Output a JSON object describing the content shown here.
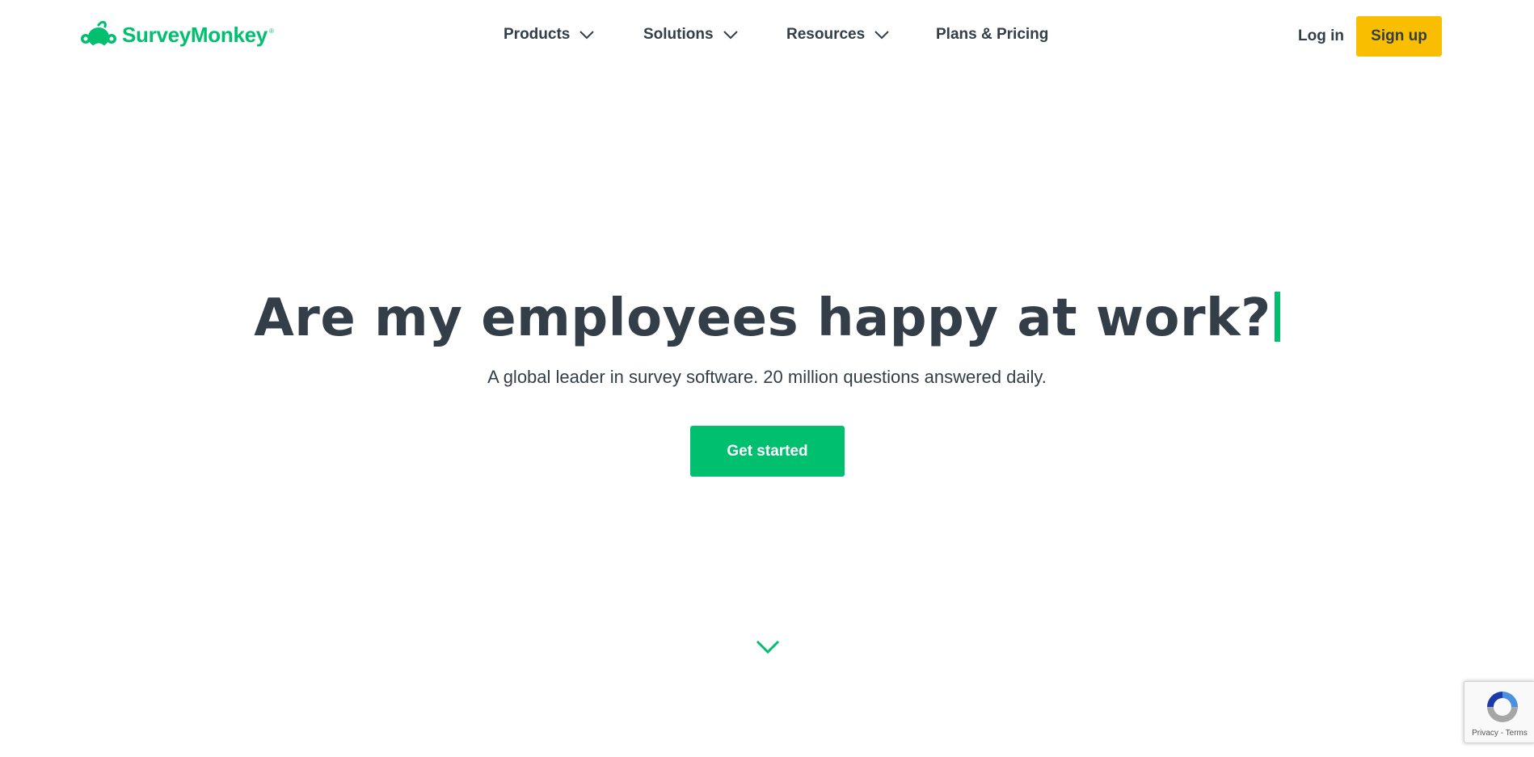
{
  "header": {
    "logo_text": "SurveyMonkey",
    "logo_reg": "®",
    "brand_color": "#00bf6f",
    "nav": [
      {
        "label": "Products",
        "has_dropdown": true
      },
      {
        "label": "Solutions",
        "has_dropdown": true
      },
      {
        "label": "Resources",
        "has_dropdown": true
      },
      {
        "label": "Plans & Pricing",
        "has_dropdown": false
      }
    ],
    "login_label": "Log in",
    "signup_label": "Sign up",
    "signup_color": "#f9be00"
  },
  "hero": {
    "title": "Are my employees happy at work?",
    "subtitle": "A global leader in survey software. 20 million questions answered daily.",
    "cta_label": "Get started",
    "cta_color": "#00bf6f"
  },
  "scroll_indicator": {
    "icon": "chevron-down-icon"
  },
  "recaptcha": {
    "privacy_label": "Privacy",
    "separator": " - ",
    "terms_label": "Terms"
  }
}
